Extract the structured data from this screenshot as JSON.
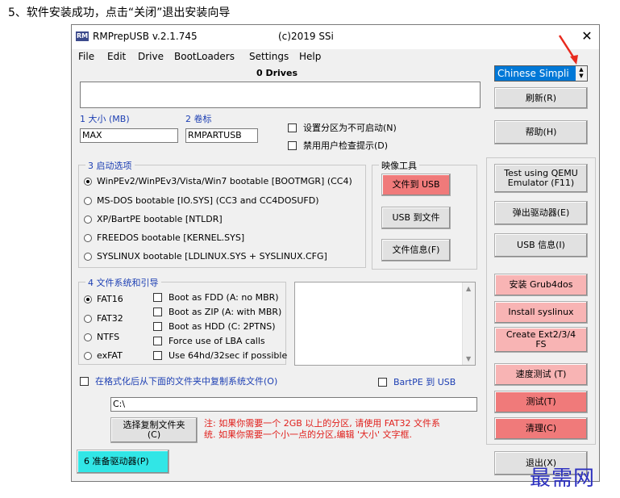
{
  "heading": "5、软件安装成功，点击“关闭”退出安装向导",
  "window": {
    "icon_text": "RM",
    "title": "RMPrepUSB v.2.1.745",
    "copyright": "(c)2019 SSi",
    "close_symbol": "✕"
  },
  "menu": [
    "File",
    "Edit",
    "Drive",
    "BootLoaders",
    "Settings",
    "Help"
  ],
  "drives_title": "0 Drives",
  "language": {
    "value": "Chinese Simpli",
    "spin_up": "▲",
    "spin_down": "▼"
  },
  "size_label": "1 大小 (MB)",
  "size_value": "MAX",
  "volume_label": "2 卷标",
  "volume_value": "RMPARTUSB",
  "options": [
    {
      "label": "设置分区为不可启动(N)",
      "checked": false
    },
    {
      "label": "禁用用户检查提示(D)",
      "checked": false
    }
  ],
  "boot_group": {
    "title": "3 启动选项",
    "items": [
      {
        "label": "WinPEv2/WinPEv3/Vista/Win7 bootable [BOOTMGR] (CC4)",
        "selected": true
      },
      {
        "label": "MS-DOS bootable [IO.SYS]   (CC3 and CC4DOSUFD)",
        "selected": false
      },
      {
        "label": "XP/BartPE bootable [NTLDR]",
        "selected": false
      },
      {
        "label": "FREEDOS bootable [KERNEL.SYS]",
        "selected": false
      },
      {
        "label": "SYSLINUX bootable [LDLINUX.SYS + SYSLINUX.CFG]",
        "selected": false
      }
    ]
  },
  "image_group": {
    "title": "映像工具",
    "file_to_usb": "文件到 USB",
    "usb_to_file": "USB 到文件",
    "file_info": "文件信息(F)"
  },
  "fs_group": {
    "title": "4 文件系统和引导",
    "fs": [
      {
        "label": "FAT16",
        "selected": true
      },
      {
        "label": "FAT32",
        "selected": false
      },
      {
        "label": "NTFS",
        "selected": false
      },
      {
        "label": "exFAT",
        "selected": false
      }
    ],
    "boot_opts": [
      "Boot as FDD (A: no MBR)",
      "Boot as ZIP (A: with MBR)",
      "Boot as HDD (C: 2PTNS)",
      "Force use of LBA calls",
      "Use 64hd/32sec if possible"
    ]
  },
  "copy_files_label": "在格式化后从下面的文件夹中复制系统文件(O)",
  "bartpe_label": "BartPE 到 USB",
  "path_value": "C:\\",
  "choose_folder_button": "选择复制文件夹\n(C)",
  "note": {
    "line1": "注: 如果你需要一个 2GB 以上的分区, 请使用 FAT32 文件系",
    "line2": "统. 如果你需要一个小一点的分区,编辑 '大小' 文字框."
  },
  "prepare_button": "6 准备驱动器(P)",
  "right_buttons": {
    "refresh": "刷新(R)",
    "help": "帮助(H)",
    "qemu": "Test using QEMU\nEmulator (F11)",
    "eject": "弹出驱动器(E)",
    "usb_info": "USB 信息(I)",
    "grub4dos": "安装 Grub4dos",
    "syslinux": "Install syslinux",
    "ext": "Create Ext2/3/4\nFS",
    "speed_test": "速度测试 (T)",
    "test": "测试(T)",
    "clean": "清理(C)",
    "exit": "退出(X)"
  },
  "watermark": "最需网",
  "colors": {
    "accent_blue": "#1d3fb3",
    "red_button": "#f07a7a",
    "pink_button": "#f8b4b4",
    "cyan_button": "#31e6e6",
    "note_red": "#e0201c"
  }
}
